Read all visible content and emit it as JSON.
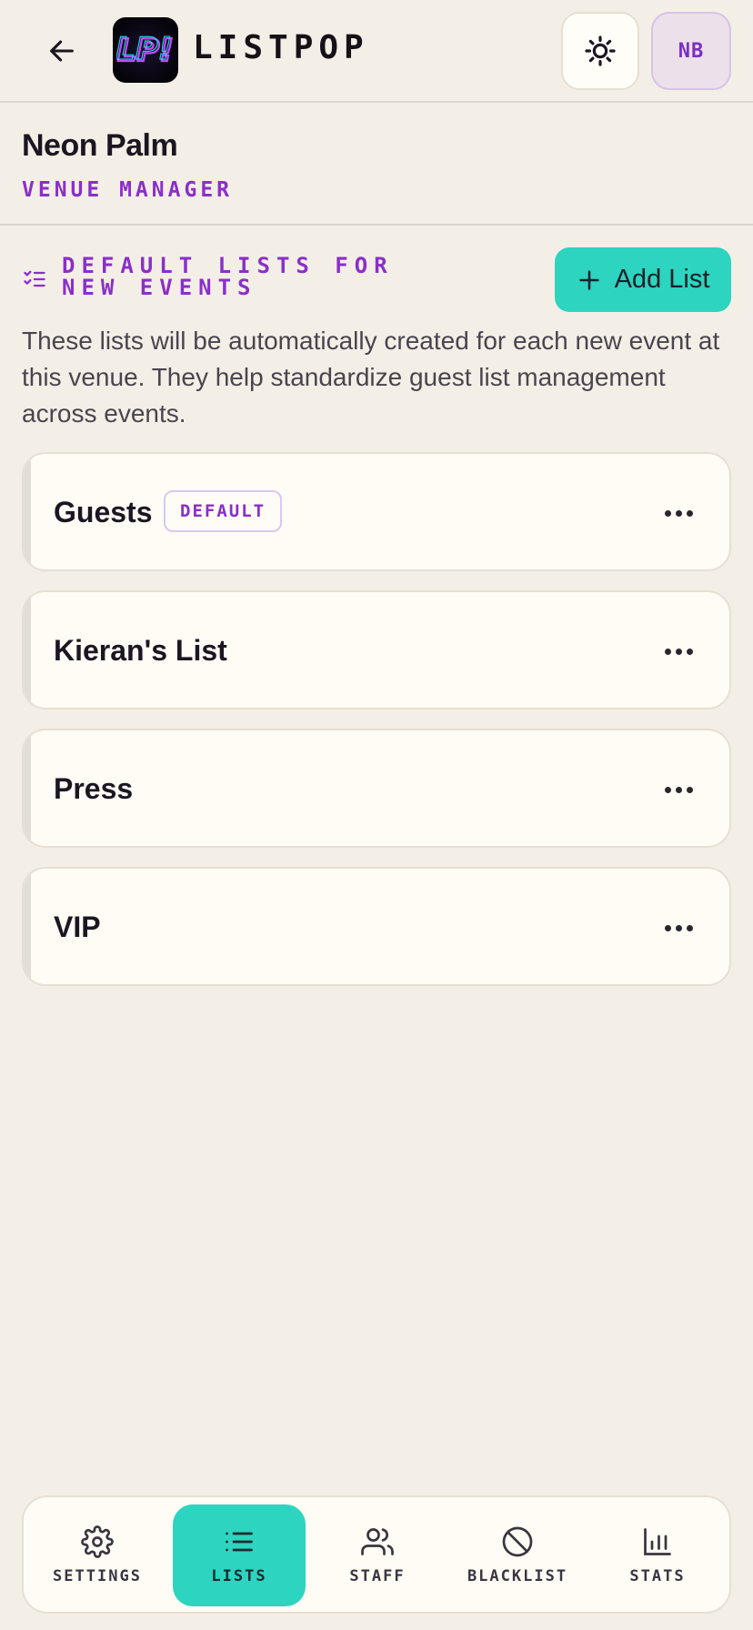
{
  "header": {
    "logo_text": "LP!",
    "app_name": "LISTPOP",
    "avatar_initials": "NB"
  },
  "venue": {
    "name": "Neon Palm",
    "role": "VENUE MANAGER"
  },
  "section": {
    "title": "DEFAULT LISTS FOR NEW EVENTS",
    "add_button_label": "Add List",
    "description": "These lists will be automatically created for each new event at this venue. They help standardize guest list management across events."
  },
  "lists": [
    {
      "name": "Guests",
      "badge": "DEFAULT"
    },
    {
      "name": "Kieran's List",
      "badge": ""
    },
    {
      "name": "Press",
      "badge": ""
    },
    {
      "name": "VIP",
      "badge": ""
    }
  ],
  "nav": {
    "items": [
      {
        "label": "SETTINGS",
        "icon": "gear-icon",
        "active": false
      },
      {
        "label": "LISTS",
        "icon": "list-icon",
        "active": true
      },
      {
        "label": "STAFF",
        "icon": "users-icon",
        "active": false
      },
      {
        "label": "BLACKLIST",
        "icon": "ban-icon",
        "active": false
      },
      {
        "label": "STATS",
        "icon": "bar-chart-icon",
        "active": false
      }
    ]
  },
  "colors": {
    "accent": "#2dd4bf",
    "brand_purple": "#8a2fc9",
    "background": "#f4efe6"
  }
}
